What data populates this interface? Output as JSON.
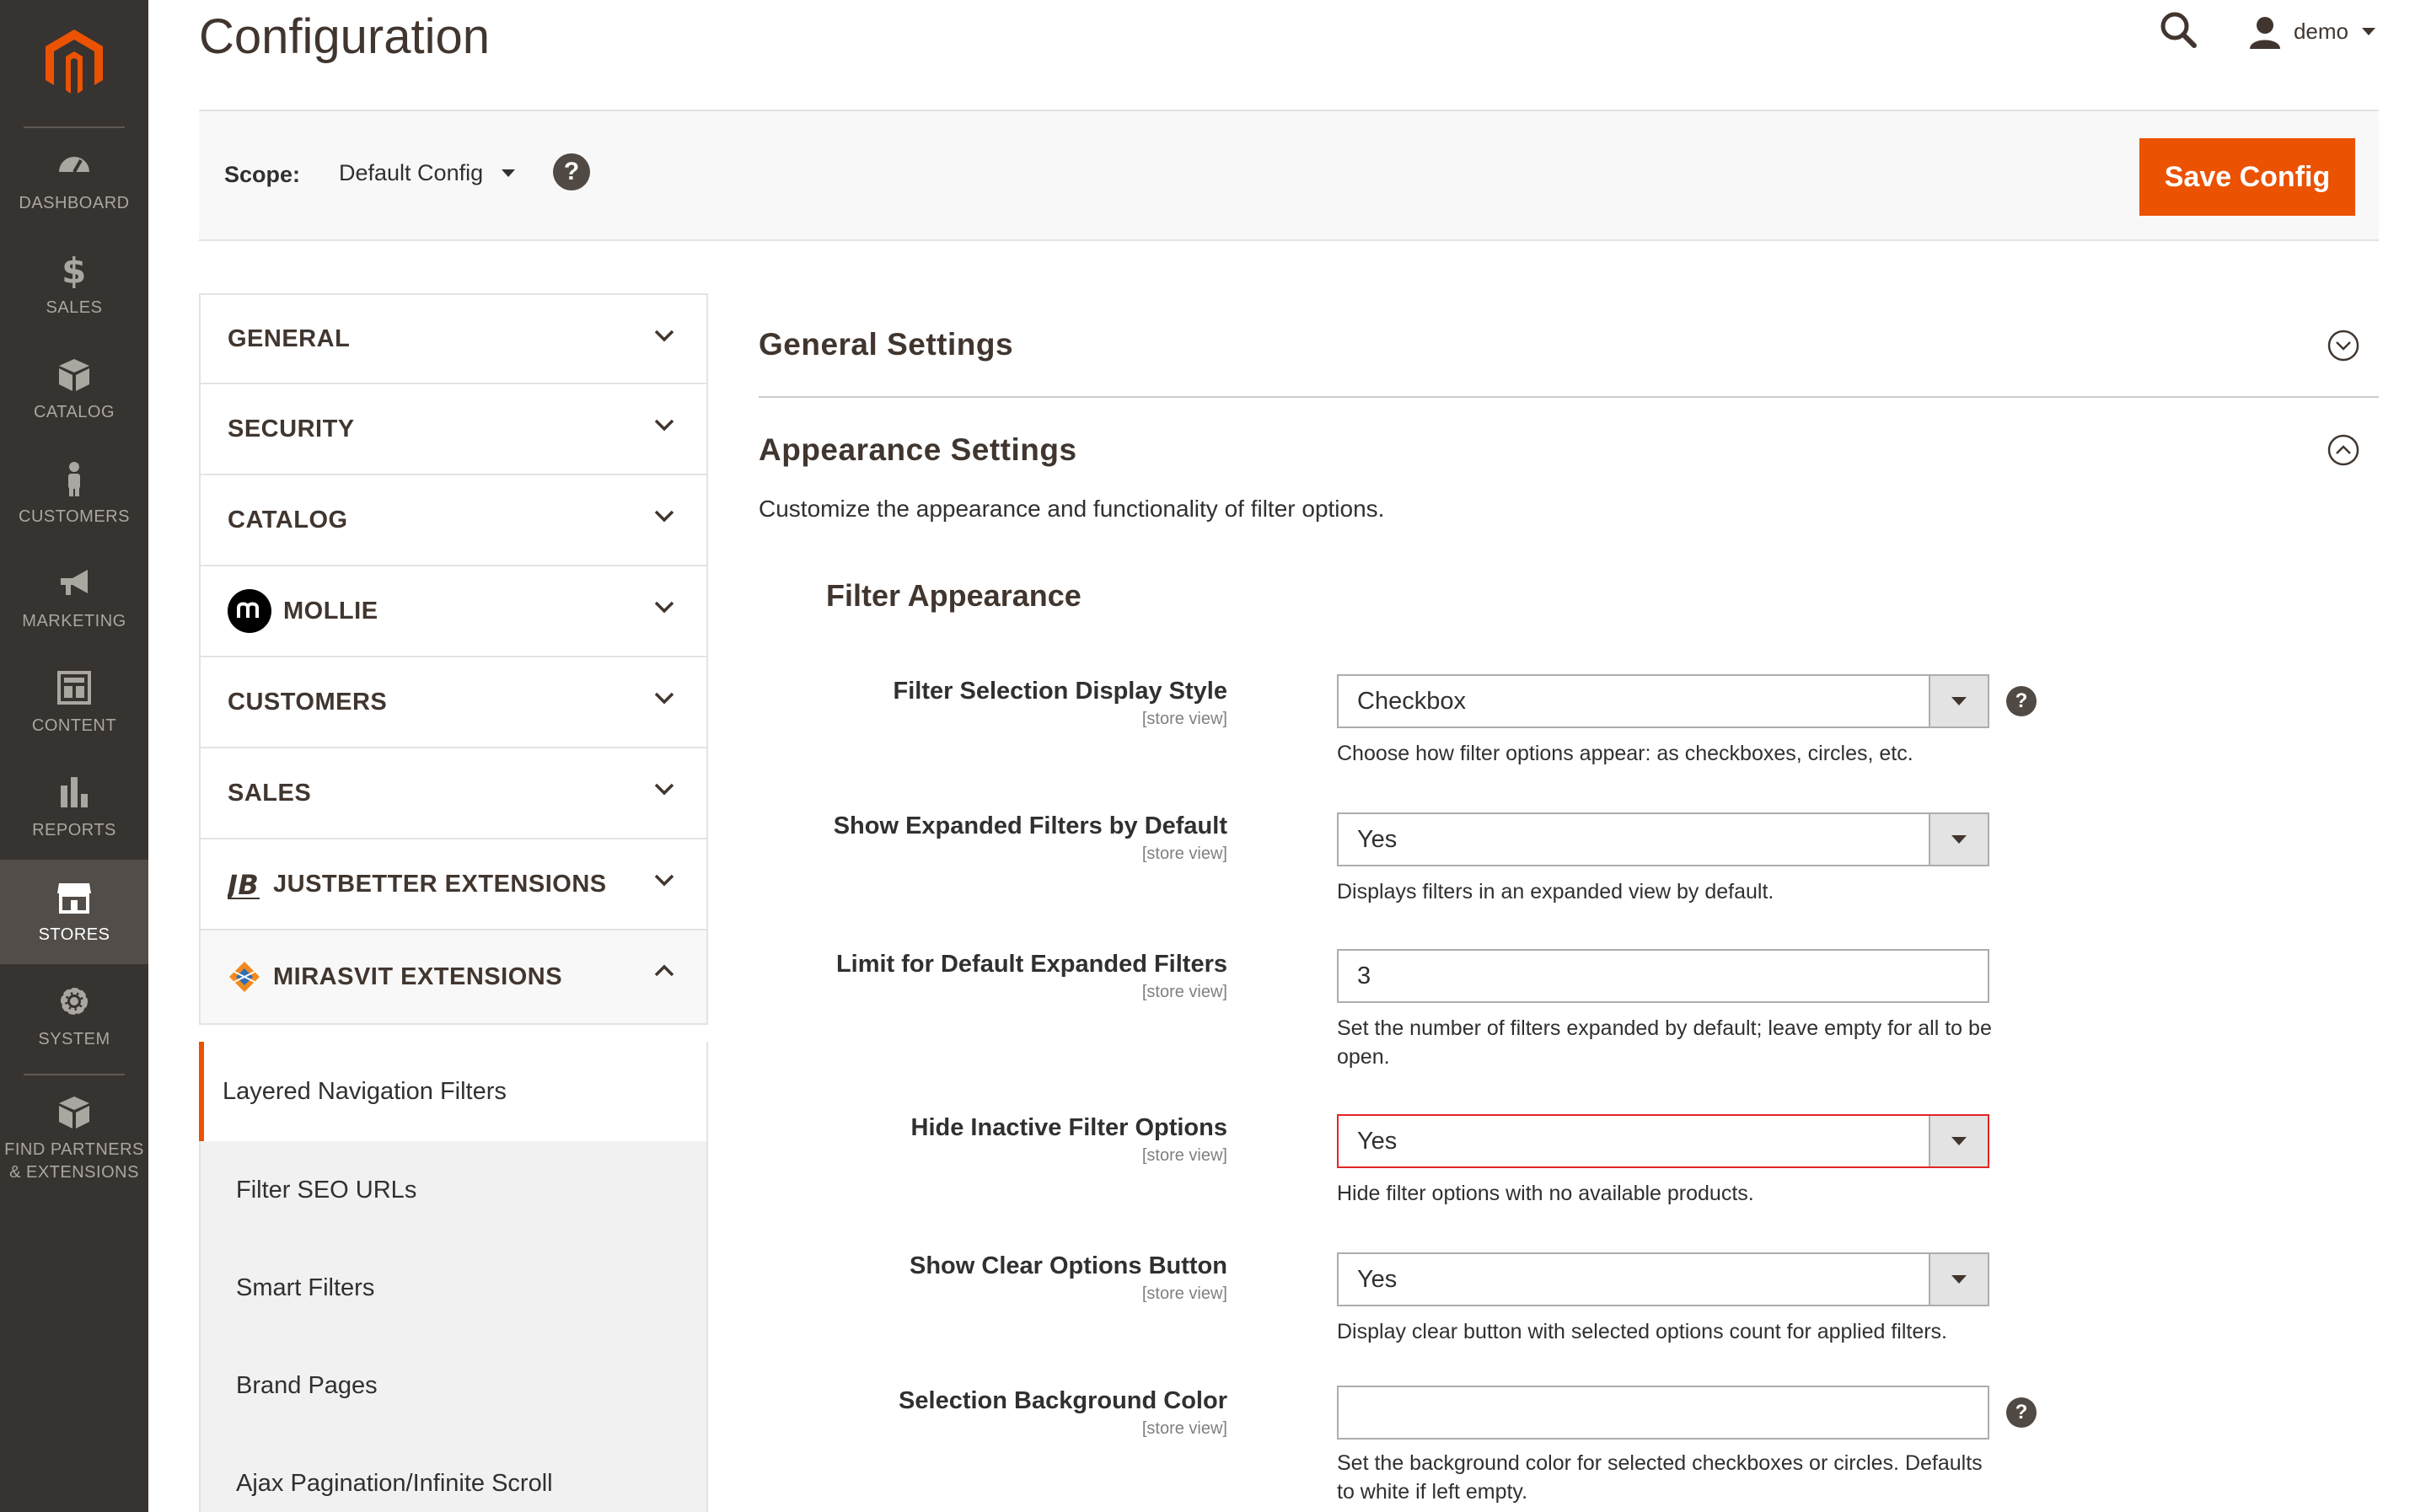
{
  "nav": {
    "items": [
      {
        "label": "DASHBOARD",
        "icon": "dashboard-icon"
      },
      {
        "label": "SALES",
        "icon": "dollar-icon"
      },
      {
        "label": "CATALOG",
        "icon": "box-icon"
      },
      {
        "label": "CUSTOMERS",
        "icon": "person-icon"
      },
      {
        "label": "MARKETING",
        "icon": "megaphone-icon"
      },
      {
        "label": "CONTENT",
        "icon": "layout-icon"
      },
      {
        "label": "REPORTS",
        "icon": "bar-chart-icon"
      },
      {
        "label": "STORES",
        "icon": "store-icon"
      },
      {
        "label": "SYSTEM",
        "icon": "gear-icon"
      }
    ],
    "partners_line1": "FIND PARTNERS",
    "partners_line2": "& EXTENSIONS"
  },
  "header": {
    "title": "Configuration",
    "user": "demo"
  },
  "scope": {
    "label": "Scope:",
    "value": "Default Config",
    "help": "?"
  },
  "toolbar": {
    "save_label": "Save Config"
  },
  "tabs": {
    "general": "GENERAL",
    "security": "SECURITY",
    "catalog": "CATALOG",
    "mollie": "MOLLIE",
    "customers": "CUSTOMERS",
    "sales": "SALES",
    "justbetter": "JUSTBETTER EXTENSIONS",
    "mirasvit": "MIRASVIT EXTENSIONS",
    "mirasvit_items": [
      "Layered Navigation Filters",
      "Filter SEO URLs",
      "Smart Filters",
      "Brand Pages",
      "Ajax Pagination/Infinite Scroll"
    ]
  },
  "main": {
    "general_settings": "General Settings",
    "appearance_settings": "Appearance Settings",
    "appearance_desc": "Customize the appearance and functionality of filter options.",
    "filter_appearance": "Filter Appearance",
    "fields": [
      {
        "label": "Filter Selection Display Style",
        "scope": "[store view]",
        "value": "Checkbox",
        "note": "Choose how filter options appear: as checkboxes, circles, etc."
      },
      {
        "label": "Show Expanded Filters by Default",
        "scope": "[store view]",
        "value": "Yes",
        "note": "Displays filters in an expanded view by default."
      },
      {
        "label": "Limit for Default Expanded Filters",
        "scope": "[store view]",
        "value": "3",
        "note": "Set the number of filters expanded by default; leave empty for all to be open."
      },
      {
        "label": "Hide Inactive Filter Options",
        "scope": "[store view]",
        "value": "Yes",
        "note": "Hide filter options with no available products."
      },
      {
        "label": "Show Clear Options Button",
        "scope": "[store view]",
        "value": "Yes",
        "note": "Display clear button with selected options count for applied filters."
      },
      {
        "label": "Selection Background Color",
        "scope": "[store view]",
        "value": "",
        "note": "Set the background color for selected checkboxes or circles. Defaults to white if left empty."
      }
    ]
  },
  "colors": {
    "accent": "#eb5202",
    "nav_bg": "#373330",
    "nav_active": "#524d49",
    "error": "#e22626"
  }
}
